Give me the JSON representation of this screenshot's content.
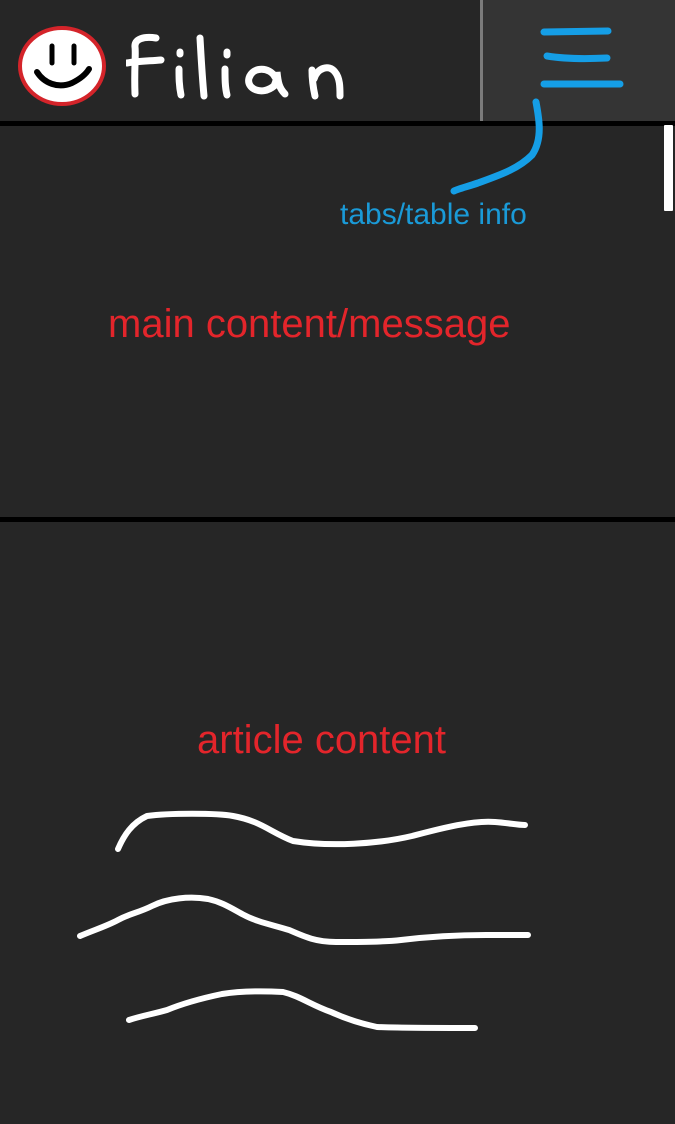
{
  "header": {
    "logo_icon": "smiley-face-icon",
    "brand_name": "filian",
    "menu_icon": "hamburger-menu-icon"
  },
  "annotations": {
    "tabs_info": "tabs/table info",
    "main_content": "main content/message",
    "article_content": "article content"
  },
  "colors": {
    "background": "#262626",
    "menu_panel": "#343434",
    "annotation_blue": "#1a9ad7",
    "annotation_red": "#e3252b",
    "divider": "#000000",
    "sketch": "#ffffff"
  },
  "scrollbar": {
    "visible": true
  }
}
